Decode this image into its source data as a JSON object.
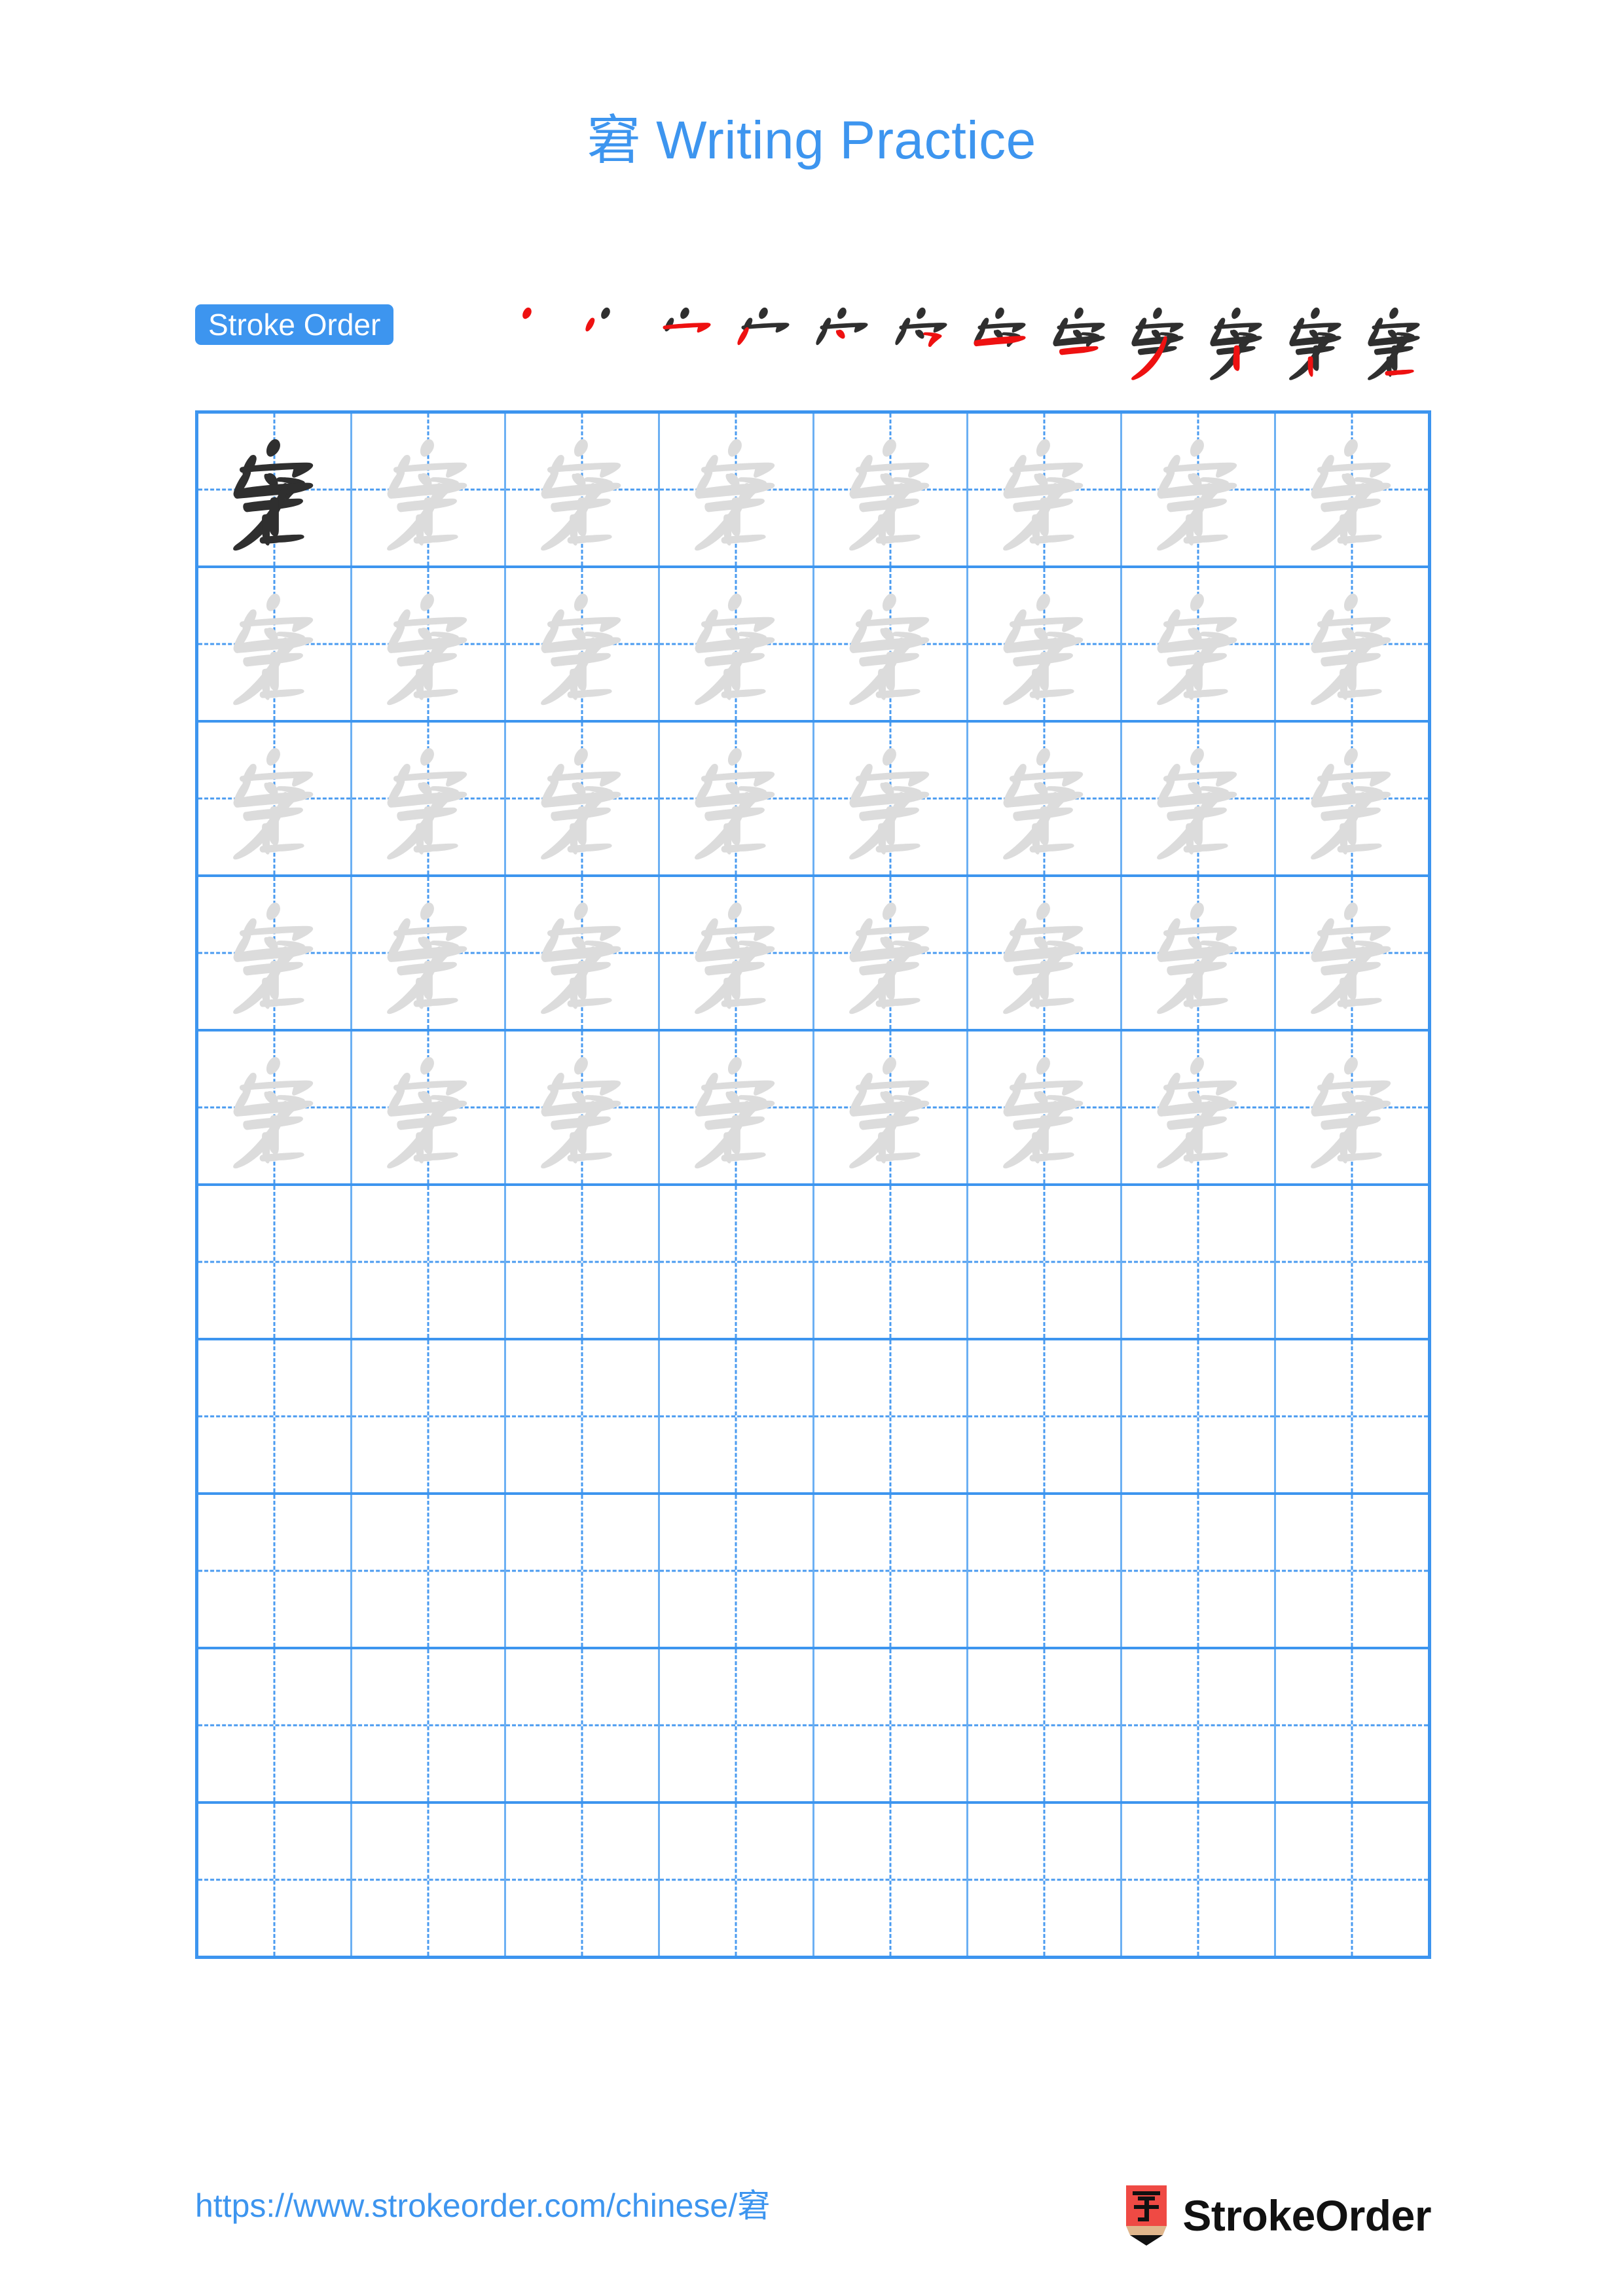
{
  "document": {
    "type": "chinese-character-writing-practice-worksheet",
    "character": "窘",
    "background_color": "#ffffff",
    "accent_color": "#3d95ef",
    "new_stroke_color": "#ee1111",
    "old_stroke_color": "#2f2f2f",
    "trace_color": "#dcdcdc"
  },
  "title": {
    "character": "窘",
    "text": " Writing Practice",
    "full": "窘 Writing Practice",
    "color": "#3d95ef"
  },
  "stroke_order": {
    "badge_label": "Stroke Order",
    "badge_bg": "#3d95ef",
    "badge_text_color": "#ffffff",
    "total_strokes": 12,
    "steps": [
      {
        "index": 1,
        "partial": "丶",
        "new_stroke": "dot"
      },
      {
        "index": 2,
        "partial": "丷",
        "new_stroke": "left-dot"
      },
      {
        "index": 3,
        "partial": "宀",
        "new_stroke": "horizontal-hook"
      },
      {
        "index": 4,
        "partial": "宀",
        "new_stroke": "left-short-slant"
      },
      {
        "index": 5,
        "partial": "穴",
        "new_stroke": "right-dot"
      },
      {
        "index": 6,
        "partial": "穵",
        "new_stroke": "horizontal-bend-hook"
      },
      {
        "index": 7,
        "partial": "空",
        "new_stroke": "horizontal"
      },
      {
        "index": 8,
        "partial": "空",
        "new_stroke": "horizontal-lower"
      },
      {
        "index": 9,
        "partial": "穿",
        "new_stroke": "left-falling"
      },
      {
        "index": 10,
        "partial": "穽",
        "new_stroke": "vertical-hook"
      },
      {
        "index": 11,
        "partial": "窘",
        "new_stroke": "short-vertical"
      },
      {
        "index": 12,
        "partial": "窘",
        "new_stroke": "final-horizontal"
      }
    ]
  },
  "practice_grid": {
    "columns": 8,
    "rows": 10,
    "filled_rows": 5,
    "empty_rows": 5,
    "grid_border_color": "#3d95ef",
    "cell_divider_color": "#6cb0f3",
    "guide_color": "#4a9bf0",
    "rows_data": [
      [
        "model",
        "trace",
        "trace",
        "trace",
        "trace",
        "trace",
        "trace",
        "trace"
      ],
      [
        "trace",
        "trace",
        "trace",
        "trace",
        "trace",
        "trace",
        "trace",
        "trace"
      ],
      [
        "trace",
        "trace",
        "trace",
        "trace",
        "trace",
        "trace",
        "trace",
        "trace"
      ],
      [
        "trace",
        "trace",
        "trace",
        "trace",
        "trace",
        "trace",
        "trace",
        "trace"
      ],
      [
        "trace",
        "trace",
        "trace",
        "trace",
        "trace",
        "trace",
        "trace",
        "trace"
      ],
      [
        "empty",
        "empty",
        "empty",
        "empty",
        "empty",
        "empty",
        "empty",
        "empty"
      ],
      [
        "empty",
        "empty",
        "empty",
        "empty",
        "empty",
        "empty",
        "empty",
        "empty"
      ],
      [
        "empty",
        "empty",
        "empty",
        "empty",
        "empty",
        "empty",
        "empty",
        "empty"
      ],
      [
        "empty",
        "empty",
        "empty",
        "empty",
        "empty",
        "empty",
        "empty",
        "empty"
      ],
      [
        "empty",
        "empty",
        "empty",
        "empty",
        "empty",
        "empty",
        "empty",
        "empty"
      ]
    ]
  },
  "footer": {
    "url": "https://www.strokeorder.com/chinese/窘",
    "url_color": "#3d95ef",
    "brand_name": "StrokeOrder",
    "logo_character": "字",
    "logo_body_color": "#ef4a44",
    "logo_tip_color": "#e0b68c",
    "logo_point_color": "#111111"
  }
}
